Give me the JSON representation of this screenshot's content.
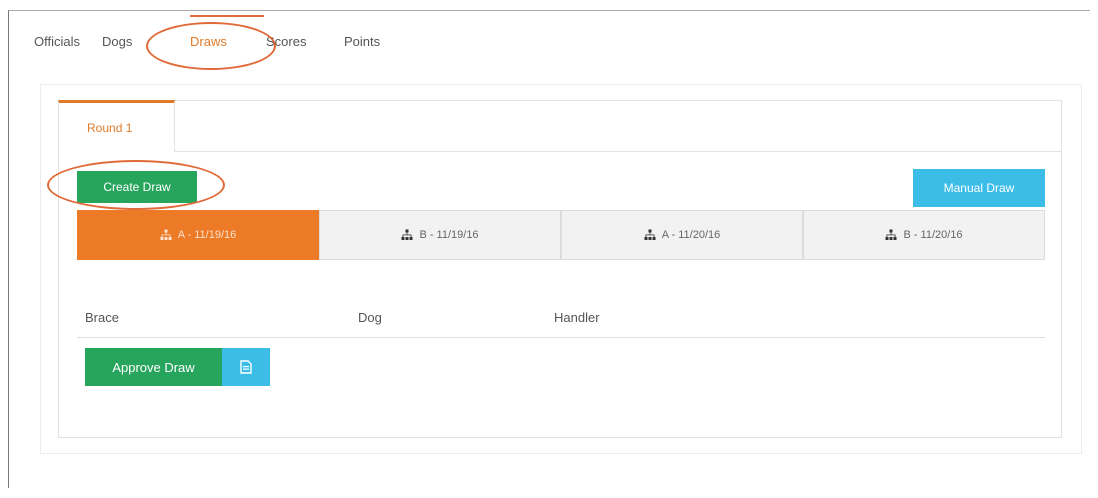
{
  "nav": {
    "items": [
      {
        "label": "Officials"
      },
      {
        "label": "Dogs"
      },
      {
        "label": "Draws"
      },
      {
        "label": "Scores"
      },
      {
        "label": "Points"
      }
    ],
    "active": "Draws"
  },
  "round_tab": {
    "label": "Round 1"
  },
  "buttons": {
    "create_draw": "Create Draw",
    "manual_draw": "Manual Draw",
    "approve_draw": "Approve Draw"
  },
  "draw_tabs": [
    {
      "label": "A - 11/19/16",
      "active": true,
      "icon": "sitemap-icon"
    },
    {
      "label": "B - 11/19/16",
      "active": false,
      "icon": "sitemap-icon"
    },
    {
      "label": "A - 11/20/16",
      "active": false,
      "icon": "sitemap-icon"
    },
    {
      "label": "B - 11/20/16",
      "active": false,
      "icon": "sitemap-icon"
    }
  ],
  "table": {
    "headers": [
      "Brace",
      "Dog",
      "Handler"
    ]
  },
  "colors": {
    "accent_orange": "#ec7a26",
    "green": "#27a55d",
    "blue": "#3bbde8",
    "annotation_red": "#e06a3a"
  }
}
